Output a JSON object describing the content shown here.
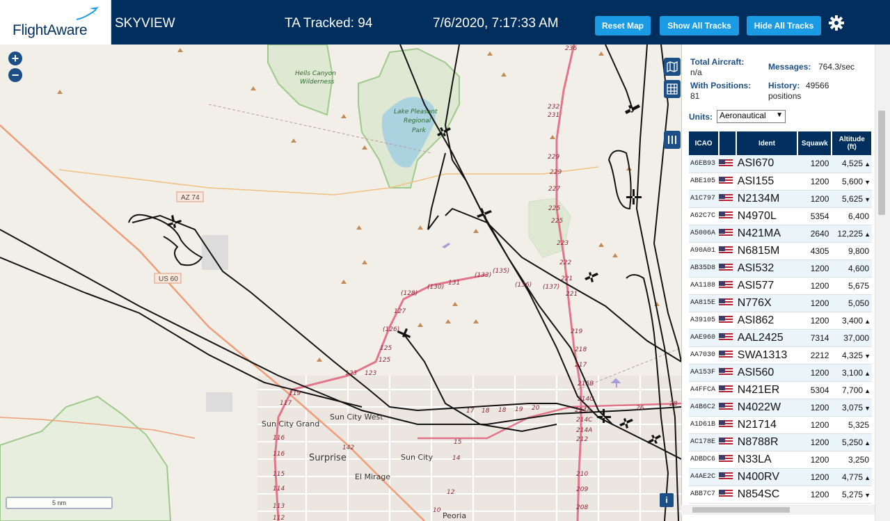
{
  "header": {
    "logo_text": "FlightAware",
    "app_name": "SKYVIEW",
    "tracked": "TA Tracked: 94",
    "datetime": "7/6/2020, 7:17:33 AM",
    "reset_map": "Reset Map",
    "show_all_tracks": "Show All Tracks",
    "hide_all_tracks": "Hide All Tracks",
    "settings_icon": "gear-icon"
  },
  "stats": {
    "total_aircraft_label": "Total Aircraft:",
    "total_aircraft_value": "n/a",
    "with_positions_label": "With Positions:",
    "with_positions_value": "81",
    "messages_label": "Messages:",
    "messages_value": "764.3/sec",
    "history_label": "History:",
    "history_value": "49566",
    "history_unit": "positions"
  },
  "units": {
    "label": "Units:",
    "selected": "Aeronautical"
  },
  "table": {
    "headers": {
      "icao": "ICAO",
      "ident": "Ident",
      "squawk": "Squawk",
      "altitude": "Altitude",
      "altitude_unit": "(ft)"
    },
    "rows": [
      {
        "icao": "A6EB93",
        "ident": "ASI670",
        "squawk": "1200",
        "altitude": "4,525",
        "trend": "▲"
      },
      {
        "icao": "ABE105",
        "ident": "ASI155",
        "squawk": "1200",
        "altitude": "5,600",
        "trend": "▼"
      },
      {
        "icao": "A1C797",
        "ident": "N2134M",
        "squawk": "1200",
        "altitude": "5,625",
        "trend": "▼"
      },
      {
        "icao": "A62C7C",
        "ident": "N4970L",
        "squawk": "5354",
        "altitude": "6,400",
        "trend": ""
      },
      {
        "icao": "A5006A",
        "ident": "N421MA",
        "squawk": "2640",
        "altitude": "12,225",
        "trend": "▲"
      },
      {
        "icao": "A90A01",
        "ident": "N6815M",
        "squawk": "4305",
        "altitude": "9,800",
        "trend": ""
      },
      {
        "icao": "AB35D8",
        "ident": "ASI532",
        "squawk": "1200",
        "altitude": "4,600",
        "trend": ""
      },
      {
        "icao": "AA1188",
        "ident": "ASI577",
        "squawk": "1200",
        "altitude": "5,675",
        "trend": ""
      },
      {
        "icao": "AA815E",
        "ident": "N776X",
        "squawk": "1200",
        "altitude": "5,050",
        "trend": ""
      },
      {
        "icao": "A39105",
        "ident": "ASI862",
        "squawk": "1200",
        "altitude": "3,400",
        "trend": "▲"
      },
      {
        "icao": "AAE960",
        "ident": "AAL2425",
        "squawk": "7314",
        "altitude": "37,000",
        "trend": ""
      },
      {
        "icao": "AA7030",
        "ident": "SWA1313",
        "squawk": "2212",
        "altitude": "4,325",
        "trend": "▼"
      },
      {
        "icao": "AA153F",
        "ident": "ASI560",
        "squawk": "1200",
        "altitude": "3,100",
        "trend": "▲"
      },
      {
        "icao": "A4FFCA",
        "ident": "N421ER",
        "squawk": "5304",
        "altitude": "7,700",
        "trend": "▲"
      },
      {
        "icao": "A4B6C2",
        "ident": "N4022W",
        "squawk": "1200",
        "altitude": "3,075",
        "trend": "▼"
      },
      {
        "icao": "A1D61B",
        "ident": "N21714",
        "squawk": "1200",
        "altitude": "5,325",
        "trend": ""
      },
      {
        "icao": "AC178E",
        "ident": "N8788R",
        "squawk": "1200",
        "altitude": "5,250",
        "trend": "▲"
      },
      {
        "icao": "ADBDC6",
        "ident": "N33LA",
        "squawk": "1200",
        "altitude": "3,250",
        "trend": ""
      },
      {
        "icao": "A4AE2C",
        "ident": "N400RV",
        "squawk": "1200",
        "altitude": "4,775",
        "trend": "▲"
      },
      {
        "icao": "ABB7C7",
        "ident": "N854SC",
        "squawk": "1200",
        "altitude": "5,275",
        "trend": "▼"
      }
    ]
  },
  "map": {
    "scale_label": "5 nm",
    "zoom_in": "+",
    "zoom_out": "−",
    "info": "i",
    "labels": {
      "hells_canyon": "Hells Canyon",
      "wilderness": "Wilderness",
      "lake1": "Lake Pleasant",
      "lake2": "Regional",
      "lake3": "Park",
      "az74": "AZ 74",
      "us60": "US 60",
      "sun_city_grand": "Sun City Grand",
      "sun_city_west": "Sun City West",
      "surprise": "Surprise",
      "sun_city": "Sun City",
      "el_mirage": "El Mirage",
      "peoria": "Peoria"
    },
    "exit_numbers": [
      "236",
      "232",
      "231",
      "229",
      "229",
      "227",
      "225",
      "225",
      "223",
      "222",
      "221",
      "221",
      "219",
      "218",
      "217",
      "215B",
      "214C",
      "214A",
      "214C",
      "214A",
      "212",
      "210",
      "209",
      "208",
      "(126)",
      "127",
      "(128)",
      "(130)",
      "131",
      "(133)",
      "(135)",
      "(136)",
      "(137)",
      "125",
      "125",
      "123",
      "123",
      "119",
      "117",
      "116",
      "116",
      "115",
      "114",
      "113",
      "112",
      "17",
      "18",
      "18",
      "19",
      "20",
      "26",
      "28",
      "14",
      "15",
      "12",
      "10",
      "142"
    ],
    "colors": {
      "header": "#002f5d",
      "button": "#1a9be3",
      "interstate": "#e3758a",
      "highway": "#ee9d78",
      "park": "#9fc98c",
      "water": "#aad3df"
    }
  }
}
